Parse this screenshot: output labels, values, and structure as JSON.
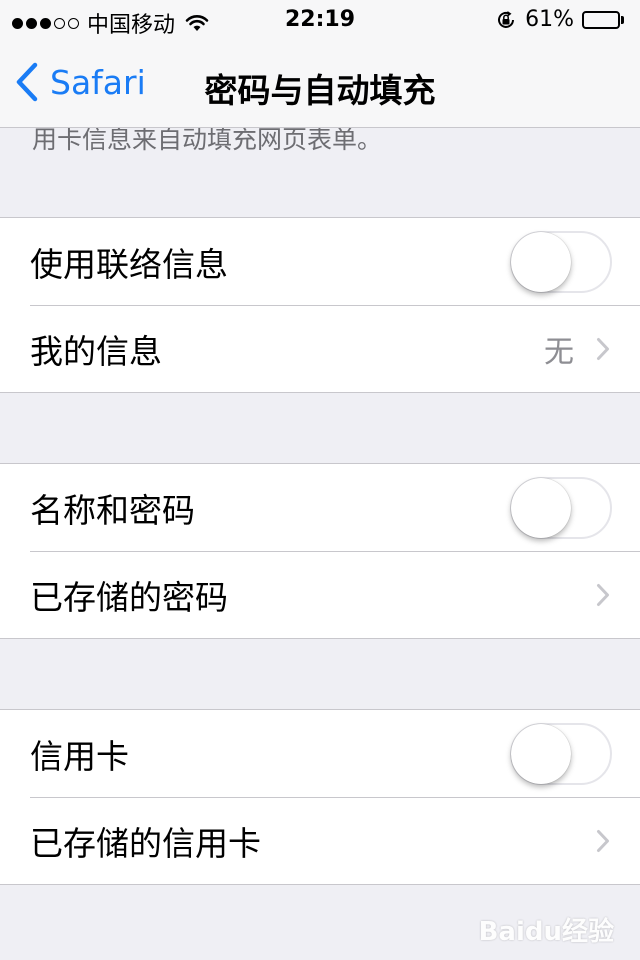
{
  "status_bar": {
    "carrier": "中国移动",
    "time": "22:19",
    "battery_percent_text": "61%",
    "battery_level": 0.61,
    "signal_bars_filled": 3,
    "signal_bars_total": 5
  },
  "nav": {
    "back_label": "Safari",
    "title": "密码与自动填充"
  },
  "intro_text": "使用您的联系信息、以前输入的名称和密码，以及信用卡信息来自动填充网页表单。",
  "groups": [
    {
      "rows": [
        {
          "label": "使用联络信息",
          "control": "toggle",
          "on": false
        },
        {
          "label": "我的信息",
          "value": "无",
          "control": "chevron"
        }
      ]
    },
    {
      "rows": [
        {
          "label": "名称和密码",
          "control": "toggle",
          "on": false
        },
        {
          "label": "已存储的密码",
          "control": "chevron"
        }
      ]
    },
    {
      "rows": [
        {
          "label": "信用卡",
          "control": "toggle",
          "on": false
        },
        {
          "label": "已存储的信用卡",
          "control": "chevron"
        }
      ]
    }
  ],
  "watermark": "Baidu经验",
  "colors": {
    "accent": "#1a7cf5",
    "background": "#efeff4",
    "separator": "#c8c7cc",
    "secondary_text": "#8e8e93"
  },
  "icons": [
    "signal-dots-icon",
    "wifi-icon",
    "lock-rotation-icon",
    "battery-icon",
    "back-chevron-icon",
    "chevron-right-icon"
  ]
}
